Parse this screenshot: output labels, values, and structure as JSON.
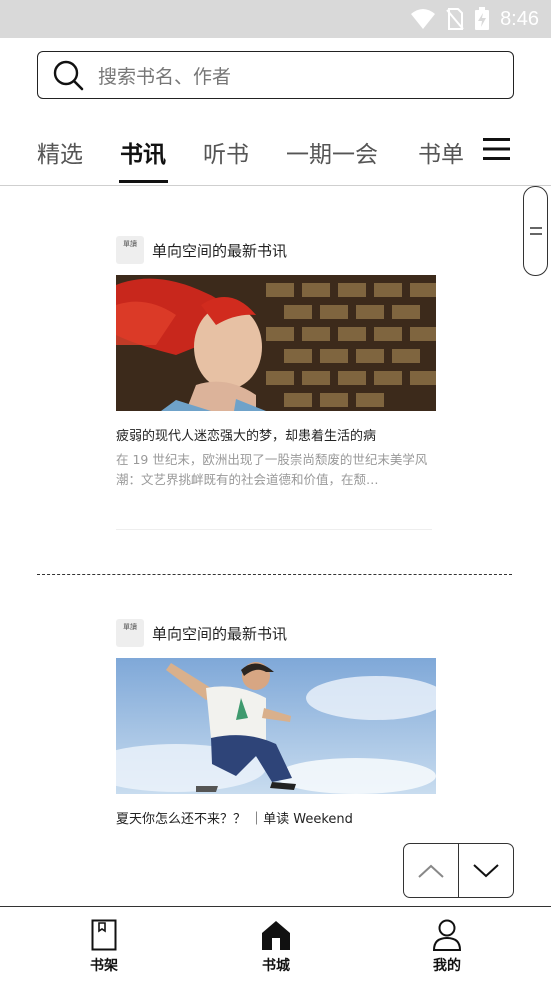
{
  "status": {
    "time": "8:46"
  },
  "search": {
    "placeholder": "搜索书名、作者"
  },
  "tabs": [
    {
      "label": "精选",
      "active": false
    },
    {
      "label": "书讯",
      "active": true
    },
    {
      "label": "听书",
      "active": false
    },
    {
      "label": "一期一会",
      "active": false
    },
    {
      "label": "书单",
      "active": false
    }
  ],
  "feed": [
    {
      "logo_text": "單讀",
      "source": "单向空间的最新书讯",
      "title": "疲弱的现代人迷恋强大的梦，却患着生活的病",
      "description": "在 19 世纪末，欧洲出现了一股崇尚颓废的世纪末美学风潮：文艺界挑衅既有的社会道德和价值，在颓…"
    },
    {
      "logo_text": "單讀",
      "source": "单向空间的最新书讯",
      "title": "夏天你怎么还不来？？ ｜单读 Weekend",
      "description": ""
    }
  ],
  "bottom_nav": [
    {
      "label": "书架",
      "icon": "bookshelf-icon"
    },
    {
      "label": "书城",
      "icon": "store-icon"
    },
    {
      "label": "我的",
      "icon": "profile-icon"
    }
  ]
}
